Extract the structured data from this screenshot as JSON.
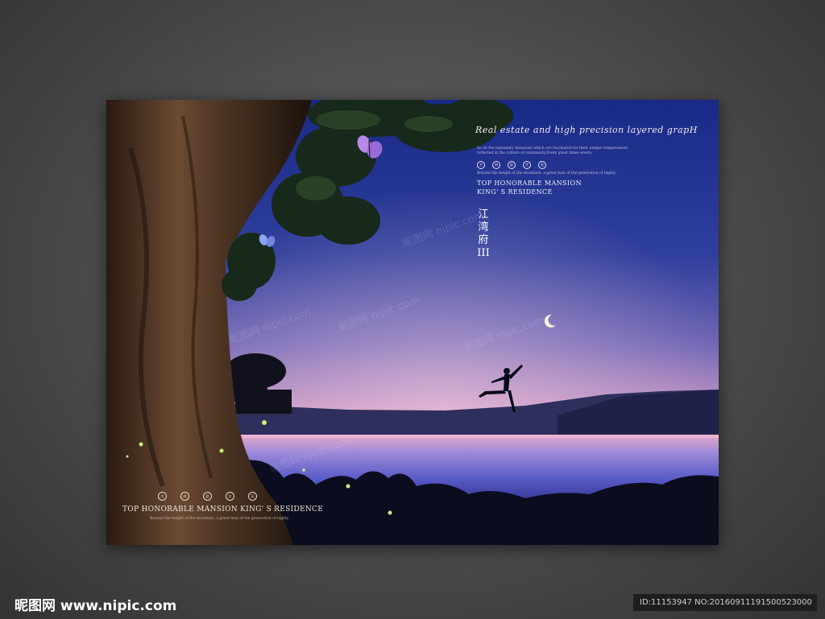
{
  "poster": {
    "headline": "Real estate and high precision layered grapH",
    "intro_line1": "So do the legendary mansions which are fascinated for their unique temperament",
    "intro_line2": "reflected in the culture of community.Every great times erects",
    "seal_chars": [
      "大",
      "府",
      "庭",
      "文",
      "苑"
    ],
    "beyond_line": "Beyond the height of the mountain, a great man of the generation of highly.",
    "tagline_1": "TOP HONORABLE MANSION",
    "tagline_2": "KING' S RESIDENCE",
    "vertical_title": [
      "江",
      "湾",
      "府",
      "III"
    ],
    "bottom_seal_chars": [
      "大",
      "府",
      "庭",
      "文",
      "苑"
    ],
    "bottom_tagline": "TOP HONORABLE MANSION KING' S RESIDENCE",
    "bottom_sub": "Beyond the height of the mountain, a great man of the generation of highly."
  },
  "watermarks": [
    "昵图网 nipic.com",
    "昵图网 nipic.com",
    "昵图网 nipic.com",
    "昵图网 nipic.com",
    "昵图网 nipic.com"
  ],
  "footer": {
    "brand": "昵图网 www.nipic.com",
    "image_id": "ID:11153947 NO:20160911191500523000"
  },
  "colors": {
    "sky_top": "#1f2f8c",
    "sky_horizon": "#e79ab9",
    "lake": "#5a62d0",
    "frame_bg": "#4a4a4a"
  }
}
